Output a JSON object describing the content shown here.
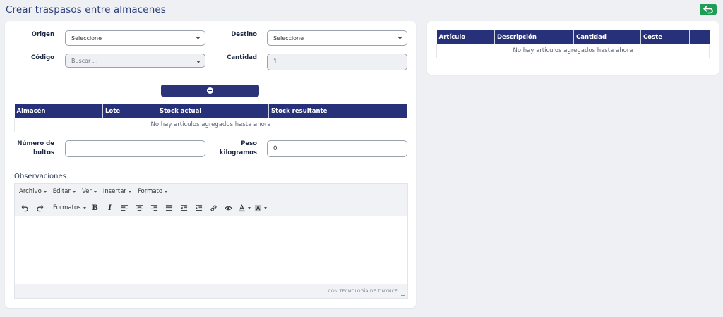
{
  "page": {
    "title": "Crear traspasos entre almacenes"
  },
  "colors": {
    "primary": "#27317a",
    "back_button": "#1f9d55",
    "background": "#eef0f4"
  },
  "form": {
    "origen_label": "Origen",
    "origen_value": "Seleccione",
    "destino_label": "Destino",
    "destino_value": "Seleccione",
    "codigo_label": "Código",
    "codigo_placeholder": "Buscar ...",
    "cantidad_label": "Cantidad",
    "cantidad_value": "1",
    "bultos_label_line1": "Número de",
    "bultos_label_line2": "bultos",
    "bultos_value": "",
    "peso_label_line1": "Peso",
    "peso_label_line2": "kilogramos",
    "peso_value": "0",
    "add_button_icon": "plus-circle-icon"
  },
  "stock_table": {
    "headers": [
      "Almacén",
      "Lote",
      "Stock actual",
      "Stock resultante"
    ],
    "empty_message": "No hay artículos agregados hasta ahora"
  },
  "observaciones": {
    "title": "Observaciones",
    "menu": [
      "Archivo",
      "Editar",
      "Ver",
      "Insertar",
      "Formato"
    ],
    "formats_label": "Formatos",
    "powered_by": "CON TECNOLOGÍA DE TINYMCE"
  },
  "articles_table": {
    "headers": [
      "Artículo",
      "Descripción",
      "Cantidad",
      "Coste",
      ""
    ],
    "empty_message": "No hay artículos agregados hasta ahora"
  }
}
